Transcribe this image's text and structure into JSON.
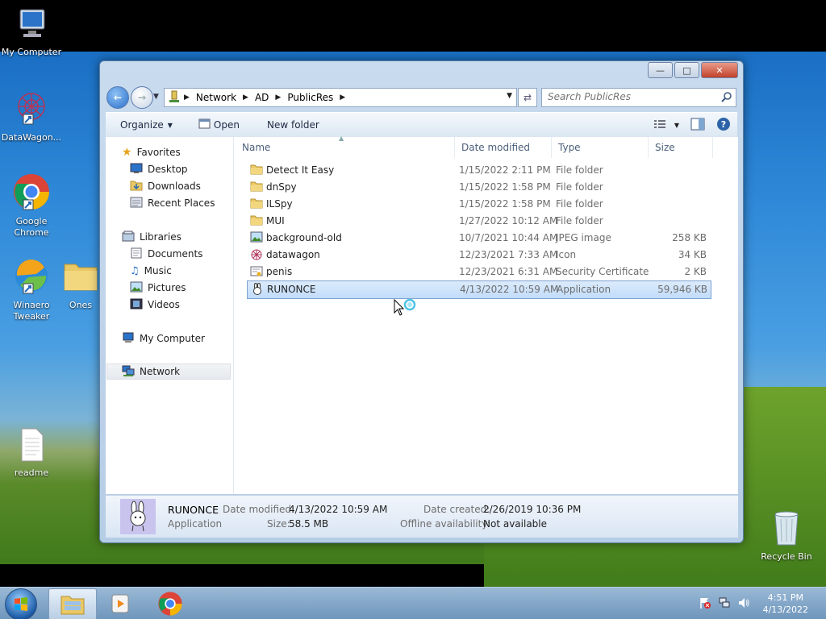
{
  "desktop": {
    "icons": [
      {
        "label": "My Computer"
      },
      {
        "label": "DataWagon..."
      },
      {
        "label": "Google Chrome"
      },
      {
        "label": "Winaero Tweaker"
      },
      {
        "label": "Ones"
      },
      {
        "label": "readme"
      },
      {
        "label": "Recycle Bin"
      }
    ]
  },
  "explorer": {
    "address": {
      "crumbs": [
        "Network",
        "AD",
        "PublicRes"
      ]
    },
    "search": {
      "placeholder": "Search PublicRes"
    },
    "toolbar": {
      "organize": "Organize",
      "open": "Open",
      "new_folder": "New folder"
    },
    "nav": {
      "favorites": "Favorites",
      "desktop": "Desktop",
      "downloads": "Downloads",
      "recent_places": "Recent Places",
      "libraries": "Libraries",
      "documents": "Documents",
      "music": "Music",
      "pictures": "Pictures",
      "videos": "Videos",
      "my_computer": "My Computer",
      "network": "Network"
    },
    "columns": {
      "name": "Name",
      "date_modified": "Date modified",
      "type": "Type",
      "size": "Size"
    },
    "files": [
      {
        "name": "Detect It Easy",
        "date": "1/15/2022 2:11 PM",
        "type": "File folder",
        "size": "",
        "icon": "folder-icon"
      },
      {
        "name": "dnSpy",
        "date": "1/15/2022 1:58 PM",
        "type": "File folder",
        "size": "",
        "icon": "folder-icon"
      },
      {
        "name": "ILSpy",
        "date": "1/15/2022 1:58 PM",
        "type": "File folder",
        "size": "",
        "icon": "folder-icon"
      },
      {
        "name": "MUI",
        "date": "1/27/2022 10:12 AM",
        "type": "File folder",
        "size": "",
        "icon": "folder-icon"
      },
      {
        "name": "background-old",
        "date": "10/7/2021 10:44 AM",
        "type": "JPEG image",
        "size": "258 KB",
        "icon": "image-file-icon"
      },
      {
        "name": "datawagon",
        "date": "12/23/2021 7:33 AM",
        "type": "Icon",
        "size": "34 KB",
        "icon": "icon-file-icon"
      },
      {
        "name": "penis",
        "date": "12/23/2021 6:31 AM",
        "type": "Security Certificate",
        "size": "2 KB",
        "icon": "certificate-icon"
      },
      {
        "name": "RUNONCE",
        "date": "4/13/2022 10:59 AM",
        "type": "Application",
        "size": "59,946 KB",
        "icon": "application-icon"
      }
    ],
    "details": {
      "name": "RUNONCE",
      "type": "Application",
      "date_modified_label": "Date modified:",
      "date_modified": "4/13/2022 10:59 AM",
      "size_label": "Size:",
      "size": "58.5 MB",
      "date_created_label": "Date created:",
      "date_created": "2/26/2019 10:36 PM",
      "offline_label": "Offline availability:",
      "offline": "Not available"
    }
  },
  "taskbar": {
    "time": "4:51 PM",
    "date": "4/13/2022"
  },
  "colors": {
    "selection": "#cce3fa",
    "accent": "#2a6fc9"
  }
}
